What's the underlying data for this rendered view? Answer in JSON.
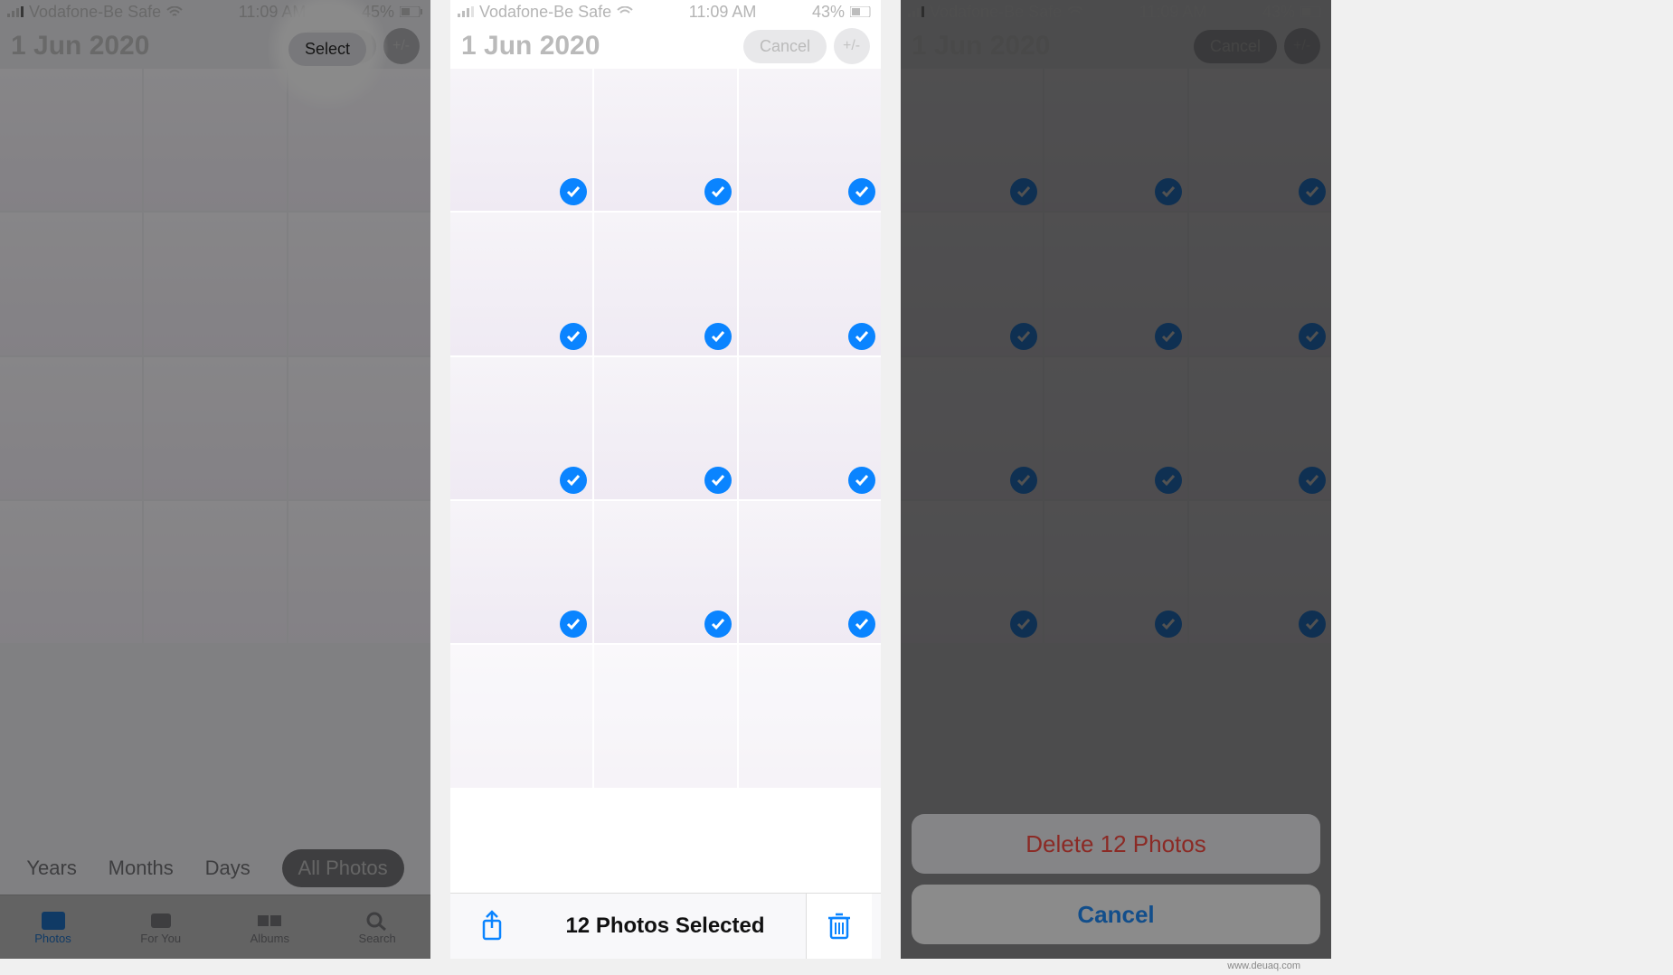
{
  "statusbar": {
    "carrier": "Vodafone-Be Safe",
    "time": "11:09 AM",
    "battery1": "45%",
    "battery2": "43%",
    "battery3": "43%"
  },
  "header": {
    "date": "1 Jun 2020",
    "select": "Select",
    "cancel": "Cancel"
  },
  "segments": {
    "years": "Years",
    "months": "Months",
    "days": "Days",
    "all": "All Photos"
  },
  "tabs": {
    "photos": "Photos",
    "foryou": "For You",
    "albums": "Albums",
    "search": "Search"
  },
  "selection": {
    "count": "12 Photos Selected"
  },
  "sheet": {
    "delete": "Delete 12 Photos",
    "cancel": "Cancel"
  },
  "watermark": "www.deuaq.com"
}
